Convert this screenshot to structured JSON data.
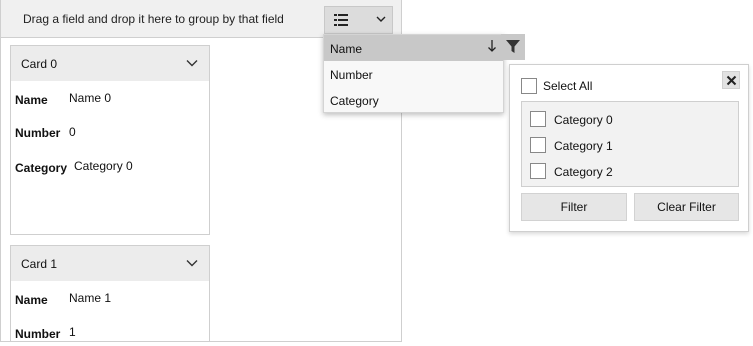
{
  "group_bar": {
    "hint": "Drag a field and drop it here to group by that field",
    "layout_icon": "list-icon",
    "dropdown_icon": "chevron-down-icon"
  },
  "cards": [
    {
      "title": "Card 0",
      "fields": [
        {
          "label": "Name",
          "value": "Name 0"
        },
        {
          "label": "Number",
          "value": "0"
        },
        {
          "label": "Category",
          "value": "Category 0"
        }
      ]
    },
    {
      "title": "Card 1",
      "fields": [
        {
          "label": "Name",
          "value": "Name 1"
        },
        {
          "label": "Number",
          "value": "1"
        }
      ]
    }
  ],
  "field_menu": {
    "items": [
      "Name",
      "Number",
      "Category"
    ],
    "selected": "Name",
    "sort_icon": "arrow-down-icon",
    "filter_icon": "filter-icon"
  },
  "filter_popup": {
    "select_all": "Select All",
    "close_icon": "close-icon",
    "options": [
      "Category 0",
      "Category 1",
      "Category 2"
    ],
    "filter_button": "Filter",
    "clear_button": "Clear Filter"
  }
}
